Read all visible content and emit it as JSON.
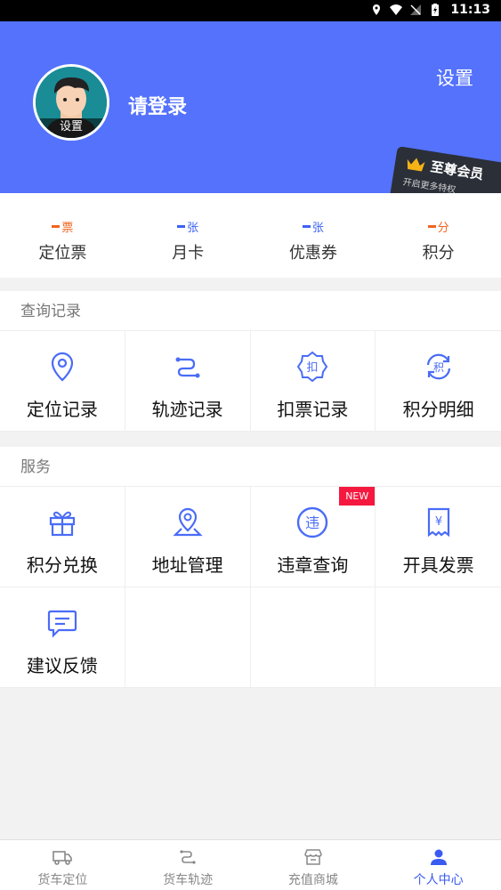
{
  "status_bar": {
    "time": "11:13"
  },
  "header": {
    "avatar_label": "设置",
    "login_text": "请登录",
    "settings_label": "设置",
    "vip": {
      "title": "至尊会员",
      "subtitle": "开启更多特权"
    }
  },
  "stats": [
    {
      "value_unit": "票",
      "label": "定位票",
      "color": "#f0641e"
    },
    {
      "value_unit": "张",
      "label": "月卡",
      "color": "#3b62f5"
    },
    {
      "value_unit": "张",
      "label": "优惠券",
      "color": "#3b62f5"
    },
    {
      "value_unit": "分",
      "label": "积分",
      "color": "#f0641e"
    }
  ],
  "query_section": {
    "title": "查询记录",
    "items": [
      {
        "label": "定位记录",
        "icon": "location-pin-icon"
      },
      {
        "label": "轨迹记录",
        "icon": "route-icon"
      },
      {
        "label": "扣票记录",
        "icon": "deduct-badge-icon",
        "glyph": "扣"
      },
      {
        "label": "积分明细",
        "icon": "points-refresh-icon",
        "glyph": "积"
      }
    ]
  },
  "service_section": {
    "title": "服务",
    "items": [
      {
        "label": "积分兑换",
        "icon": "gift-icon"
      },
      {
        "label": "地址管理",
        "icon": "map-pin-icon"
      },
      {
        "label": "违章查询",
        "icon": "violation-icon",
        "glyph": "违",
        "badge": "NEW"
      },
      {
        "label": "开具发票",
        "icon": "invoice-icon",
        "glyph": "¥"
      },
      {
        "label": "建议反馈",
        "icon": "feedback-icon"
      }
    ]
  },
  "tabbar": {
    "items": [
      {
        "label": "货车定位",
        "icon": "truck-icon"
      },
      {
        "label": "货车轨迹",
        "icon": "route-icon"
      },
      {
        "label": "充值商城",
        "icon": "store-icon"
      },
      {
        "label": "个人中心",
        "icon": "person-icon"
      }
    ],
    "active_index": 3
  },
  "colors": {
    "primary": "#5472fb",
    "icon_blue": "#4a6cf7",
    "new_badge": "#f5193f"
  }
}
